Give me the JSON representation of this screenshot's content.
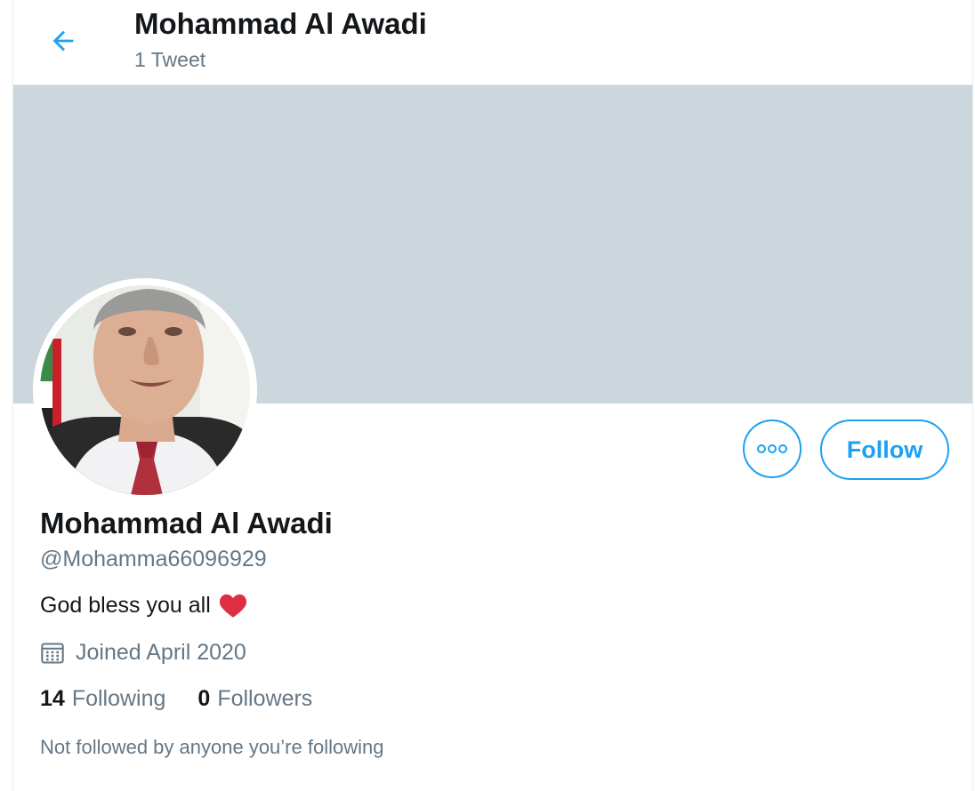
{
  "header": {
    "title": "Mohammad Al Awadi",
    "tweet_count": "1 Tweet",
    "back_icon": "arrow-left-icon"
  },
  "profile": {
    "name": "Mohammad Al Awadi",
    "handle": "@Mohamma66096929",
    "bio": "God bless you all",
    "bio_emoji": "heart-icon",
    "joined": "Joined April 2020",
    "following_count": "14",
    "following_label": "Following",
    "followers_count": "0",
    "followers_label": "Followers",
    "mutual_note": "Not followed by anyone you’re following"
  },
  "actions": {
    "follow_label": "Follow",
    "more_icon": "more-options-icon"
  },
  "colors": {
    "accent": "#1da1f2",
    "banner": "#ccd6dd",
    "text_primary": "#14171a",
    "text_secondary": "#657786",
    "heart": "#e0245e"
  }
}
